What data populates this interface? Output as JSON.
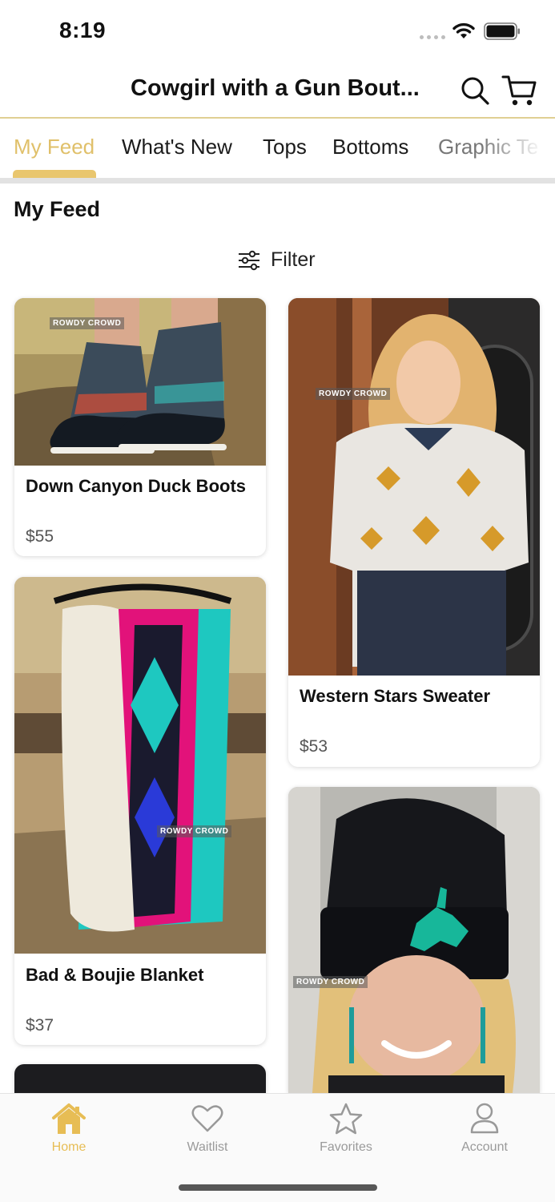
{
  "status_bar": {
    "time": "8:19"
  },
  "header": {
    "title": "Cowgirl with a Gun Bout..."
  },
  "tabs": [
    {
      "label": "My Feed",
      "active": true
    },
    {
      "label": "What's New",
      "active": false
    },
    {
      "label": "Tops",
      "active": false
    },
    {
      "label": "Bottoms",
      "active": false
    },
    {
      "label": "Graphic Te",
      "active": false
    }
  ],
  "section": {
    "title": "My Feed",
    "filter_label": "Filter"
  },
  "products": [
    {
      "name": "Down Canyon Duck Boots",
      "price": "$55",
      "watermark": "ROWDY CROWD"
    },
    {
      "name": "Western Stars Sweater",
      "price": "$53",
      "watermark": "ROWDY CROWD"
    },
    {
      "name": "Bad & Boujie Blanket",
      "price": "$37",
      "watermark": "ROWDY CROWD"
    },
    {
      "name": "",
      "price": "",
      "watermark": "ROWDY CROWD"
    }
  ],
  "bottom_nav": [
    {
      "label": "Home",
      "icon": "home-icon",
      "active": true
    },
    {
      "label": "Waitlist",
      "icon": "heart-icon",
      "active": false
    },
    {
      "label": "Favorites",
      "icon": "star-icon",
      "active": false
    },
    {
      "label": "Account",
      "icon": "person-icon",
      "active": false
    }
  ],
  "colors": {
    "accent": "#e9c66e",
    "header_border": "#e0cf93",
    "inactive": "#9a9a9a"
  }
}
